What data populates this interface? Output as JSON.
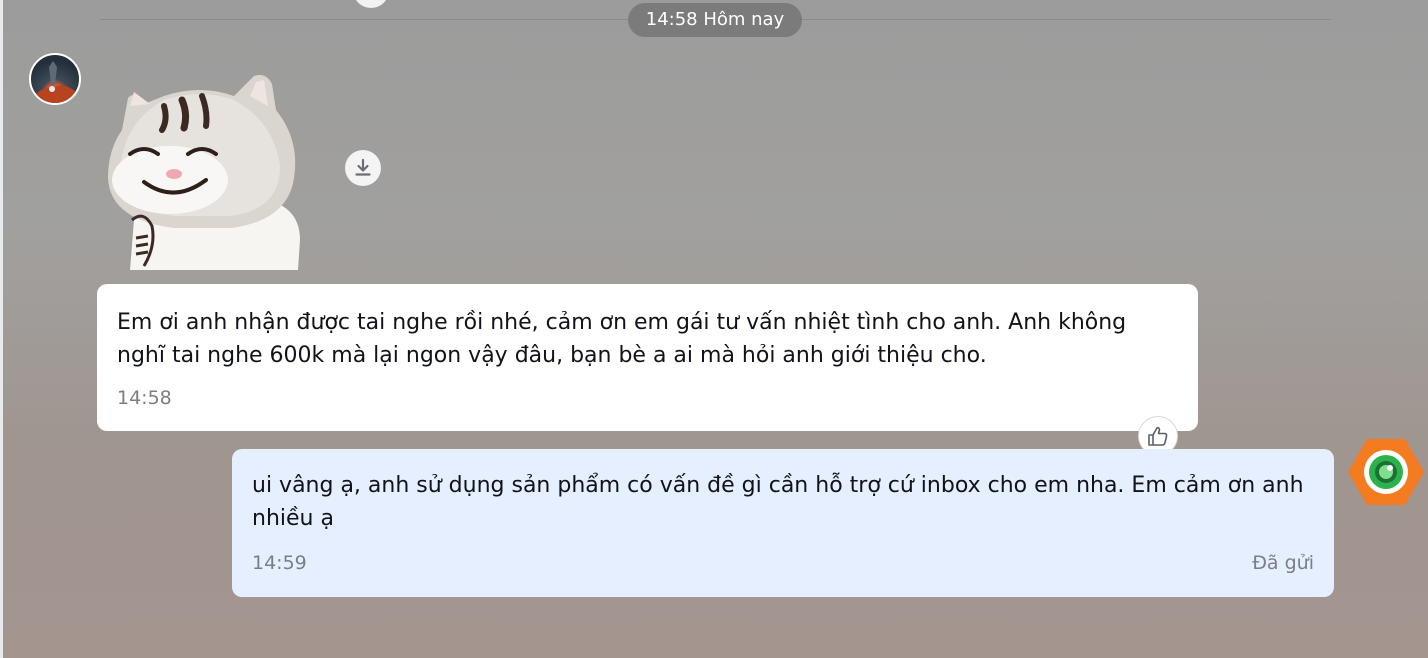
{
  "date_divider": {
    "label": "14:58 Hôm nay"
  },
  "messages": [
    {
      "direction": "received",
      "text": "Em ơi anh nhận được tai nghe rồi nhé, cảm ơn em gái tư vấn nhiệt tình cho anh. Anh không nghĩ tai nghe 600k mà lại ngon vậy đâu, bạn bè a ai mà hỏi anh giới thiệu cho.",
      "time": "14:58"
    },
    {
      "direction": "sent",
      "text": "ui vâng ạ, anh sử dụng sản phẩm có vấn đề gì cần hỗ trợ cứ inbox cho em nha. Em cảm ơn anh nhiều ạ",
      "time": "14:59",
      "status": "Đã gửi"
    }
  ],
  "icons": {
    "download": "download-icon",
    "reaction": "thumbs-up-icon",
    "app_badge": "camera-lens-icon"
  },
  "colors": {
    "sent_bubble": "#e5efff",
    "received_bubble": "#ffffff",
    "badge_orange": "#f47b20",
    "badge_green": "#2bb24c"
  }
}
